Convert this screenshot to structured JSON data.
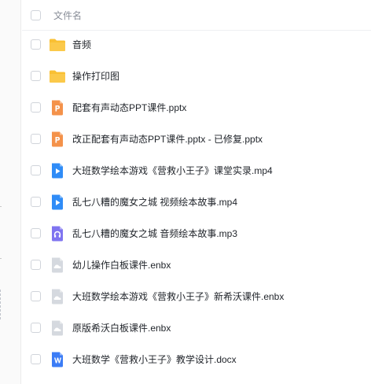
{
  "header": {
    "name_column": "文件名"
  },
  "colors": {
    "folder": "#f9c034",
    "pptx": "#f4924a",
    "video": "#2f8cf7",
    "audio": "#7f74f0",
    "enbx": "#d5d9df",
    "docx": "#3b7cf6"
  },
  "files": [
    {
      "name": "音频",
      "icon": "folder-icon"
    },
    {
      "name": "操作打印图",
      "icon": "folder-icon"
    },
    {
      "name": "配套有声动态PPT课件.pptx",
      "icon": "pptx-icon"
    },
    {
      "name": "改正配套有声动态PPT课件.pptx  -  已修复.pptx",
      "icon": "pptx-icon"
    },
    {
      "name": "大班数学绘本游戏《营救小王子》课堂实录.mp4",
      "icon": "video-icon"
    },
    {
      "name": "乱七八糟的魔女之城  视频绘本故事.mp4",
      "icon": "video-icon"
    },
    {
      "name": "乱七八糟的魔女之城  音频绘本故事.mp3",
      "icon": "audio-icon"
    },
    {
      "name": "幼儿操作白板课件.enbx",
      "icon": "enbx-icon"
    },
    {
      "name": "大班数学绘本游戏《营救小王子》新希沃课件.enbx",
      "icon": "enbx-icon"
    },
    {
      "name": "原版希沃白板课件.enbx",
      "icon": "enbx-icon"
    },
    {
      "name": "大班数学《营救小王子》教学设计.docx",
      "icon": "docx-icon"
    }
  ]
}
